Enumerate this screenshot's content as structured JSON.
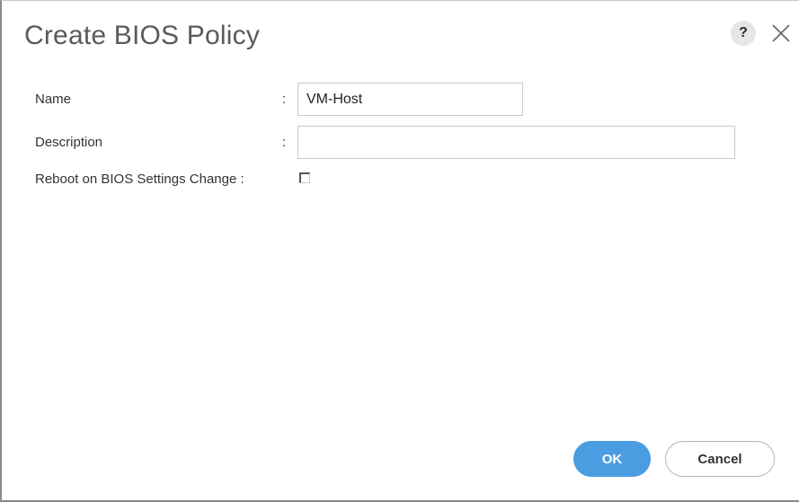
{
  "dialog": {
    "title": "Create BIOS Policy",
    "help_label": "?",
    "close_label": "×"
  },
  "form": {
    "name": {
      "label": "Name",
      "separator": ":",
      "value": "VM-Host",
      "placeholder": ""
    },
    "description": {
      "label": "Description",
      "separator": ":",
      "value": "",
      "placeholder": ""
    },
    "reboot": {
      "label": "Reboot on BIOS Settings Change :",
      "checked": false
    }
  },
  "footer": {
    "ok_label": "OK",
    "cancel_label": "Cancel"
  },
  "colors": {
    "ok_button": "#4a9de0",
    "title_text": "#5a5a5a"
  }
}
